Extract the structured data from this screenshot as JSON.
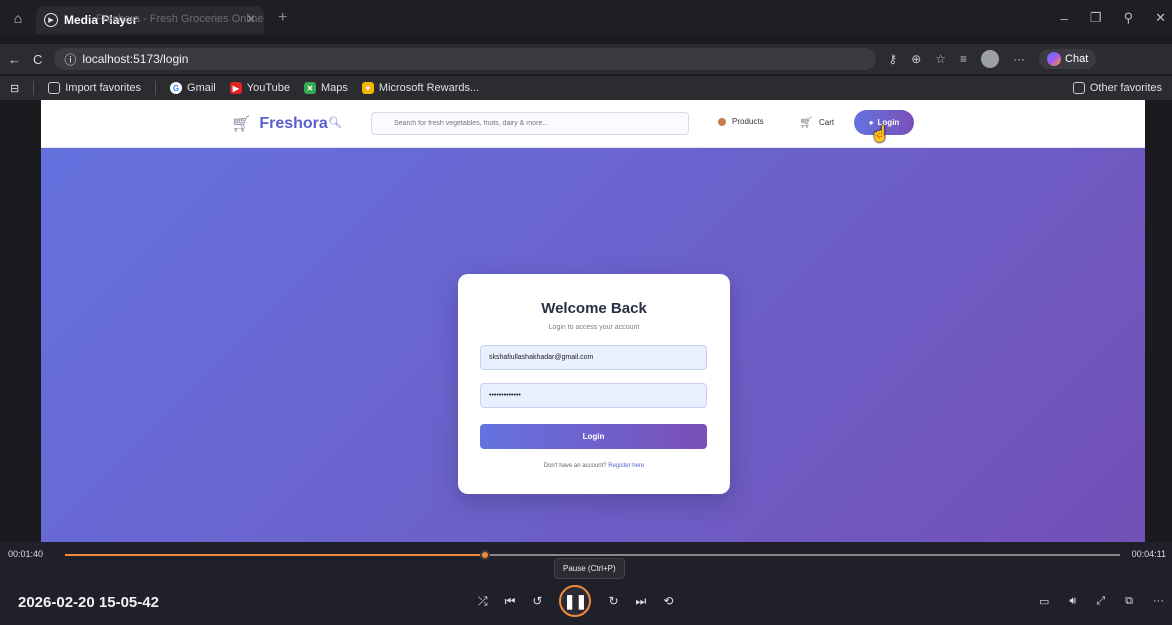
{
  "browser": {
    "tab_app": "Media Player",
    "tab_ghost_title": "Freshora - Fresh Groceries Online",
    "url": "localhost:5173/login",
    "chat_label": "Chat",
    "favorites": [
      "Import favorites",
      "Gmail",
      "YouTube",
      "Maps",
      "Microsoft Rewards..."
    ],
    "other_favorites": "Other favorites"
  },
  "site": {
    "brand": "Freshora",
    "search_placeholder": "Search for fresh vegetables, fruits, dairy & more...",
    "nav_products": "Products",
    "nav_cart": "Cart",
    "nav_login": "Login"
  },
  "login_card": {
    "title": "Welcome Back",
    "subtitle": "Login to access your account",
    "email_value": "skshafiullashakhadar@gmail.com",
    "password_value": "•••••••••••••",
    "button": "Login",
    "footer_text": "Don't have an account?",
    "footer_link": "Register here"
  },
  "player": {
    "elapsed": "00:01:40",
    "total": "00:04:11",
    "progress": 0.3985,
    "tooltip": "Pause (Ctrl+P)",
    "title": "2026-02-20 15-05-42",
    "accent": "#f08a3a"
  }
}
